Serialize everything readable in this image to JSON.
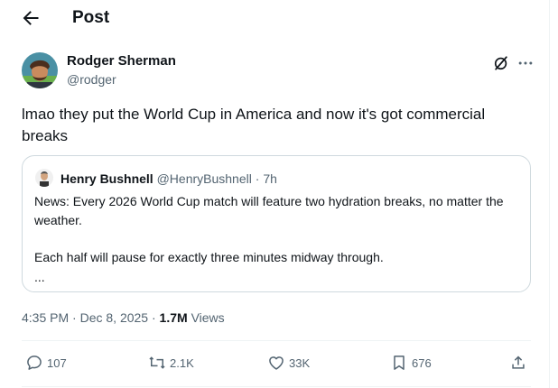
{
  "header": {
    "title": "Post"
  },
  "author": {
    "name": "Rodger Sherman",
    "handle": "@rodger"
  },
  "post": {
    "text": "lmao they put the World Cup in America and now it's got commercial breaks"
  },
  "quote": {
    "name": "Henry Bushnell",
    "handle": "@HenryBushnell",
    "time": "7h",
    "line1": "News: Every 2026 World Cup match will feature two hydration breaks, no matter the weather.",
    "line2": "Each half will pause for exactly three minutes midway through.",
    "ellipsis": "..."
  },
  "meta": {
    "time": "4:35 PM",
    "date": "Dec 8, 2025",
    "views_count": "1.7M",
    "views_label": "Views"
  },
  "actions": {
    "replies": "107",
    "reposts": "2.1K",
    "likes": "33K",
    "bookmarks": "676"
  },
  "colors": {
    "text": "#0f1419",
    "secondary": "#536471",
    "border": "#cfd9de",
    "divider": "#eff3f4"
  },
  "icons": [
    "back-arrow-icon",
    "grok-icon",
    "more-icon",
    "reply-icon",
    "repost-icon",
    "like-icon",
    "bookmark-icon",
    "share-icon"
  ]
}
